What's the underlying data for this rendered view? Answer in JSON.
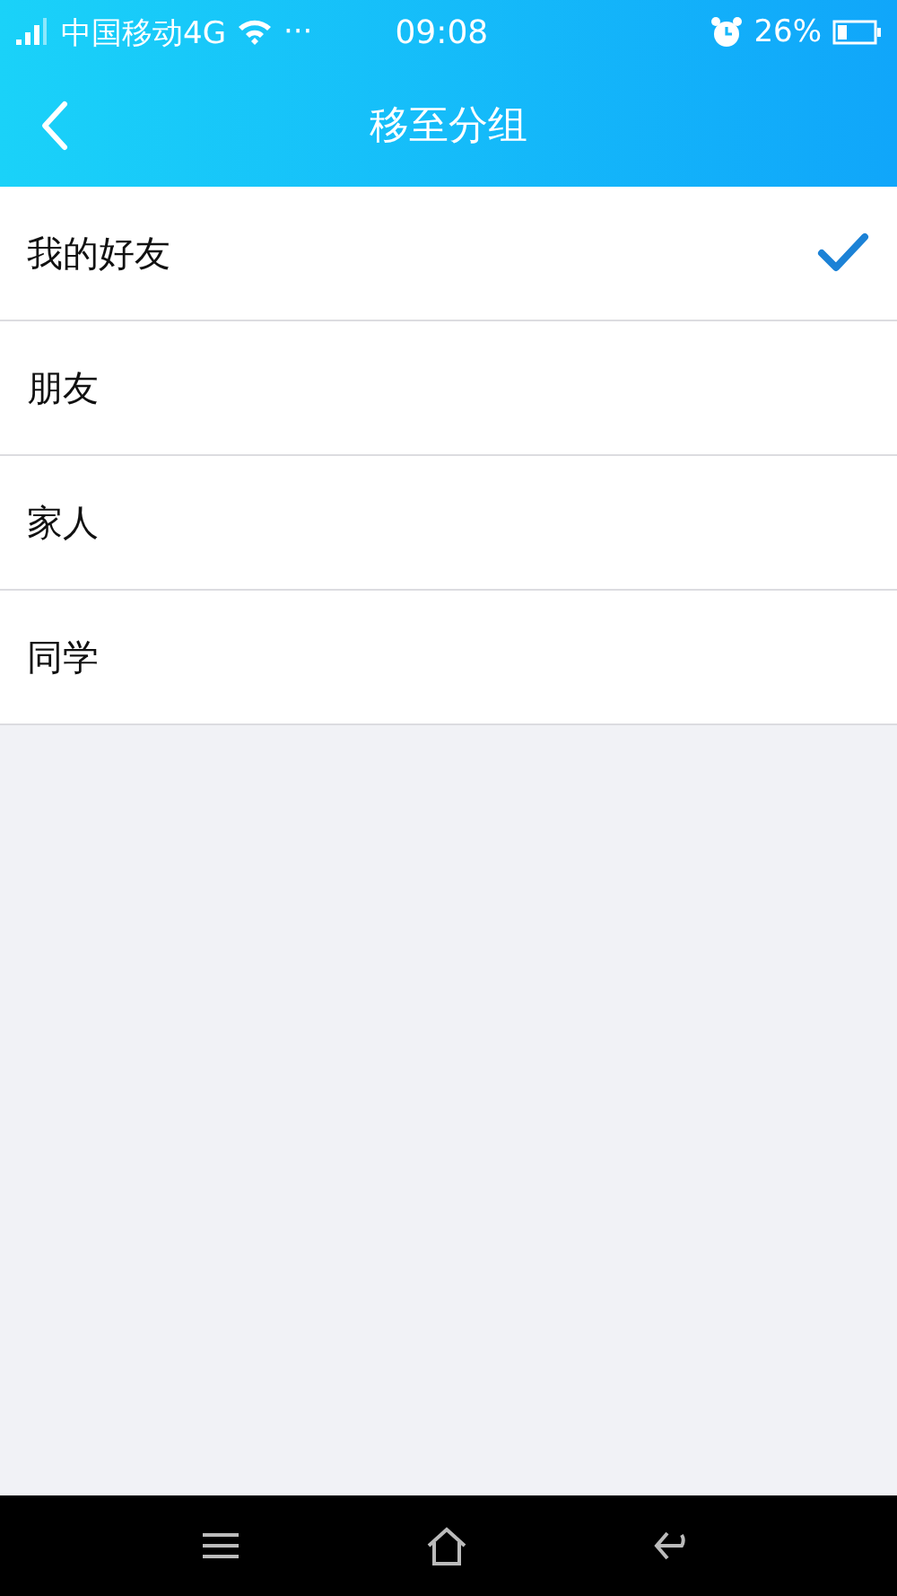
{
  "status_bar": {
    "carrier": "中国移动4G",
    "more": "···",
    "time": "09:08",
    "battery_text": "26%"
  },
  "nav_bar": {
    "title": "移至分组"
  },
  "groups": [
    {
      "label": "我的好友",
      "selected": true
    },
    {
      "label": "朋友",
      "selected": false
    },
    {
      "label": "家人",
      "selected": false
    },
    {
      "label": "同学",
      "selected": false
    }
  ]
}
